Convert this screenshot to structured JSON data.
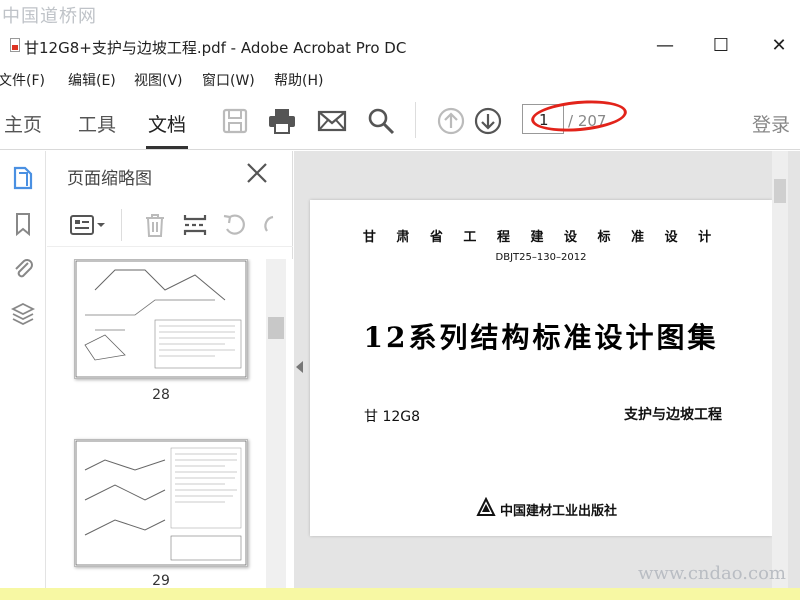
{
  "watermark": {
    "top_left": "中国道桥网",
    "bottom_right": "www.cndao.com"
  },
  "window": {
    "title": "甘12G8+支护与边坡工程.pdf - Adobe Acrobat Pro DC",
    "minimize": "—",
    "maximize": "☐",
    "close": "✕"
  },
  "menu": [
    "文件(F)",
    "编辑(E)",
    "视图(V)",
    "窗口(W)",
    "帮助(H)"
  ],
  "tabs": {
    "home": "主页",
    "tools": "工具",
    "document": "文档",
    "active": "document"
  },
  "pagenav": {
    "current": "1",
    "total": "/ 207"
  },
  "login": "登录",
  "panel": {
    "title": "页面缩略图",
    "thumbs": [
      {
        "label": "28"
      },
      {
        "label": "29"
      }
    ]
  },
  "document": {
    "header": "甘 肃 省 工 程 建 设 标 准 设 计",
    "code": "DBJT25–130–2012",
    "main_title": "12系列结构标准设计图集",
    "left": "甘 12G8",
    "right": "支护与边坡工程",
    "publisher": "中国建材工业出版社"
  },
  "colors": {
    "highlight": "#e2231a",
    "icon_active": "#4a90e2",
    "icon_gray": "#555555",
    "icon_disabled": "#bbbbbb"
  },
  "icons": [
    "save-icon",
    "print-icon",
    "mail-icon",
    "search-icon",
    "page-up-icon",
    "page-down-icon",
    "page-thumbnail-icon",
    "bookmark-icon",
    "attachment-icon",
    "layers-icon",
    "close-icon",
    "options-icon",
    "delete-icon",
    "insert-icon",
    "undo-icon",
    "redo-icon"
  ]
}
